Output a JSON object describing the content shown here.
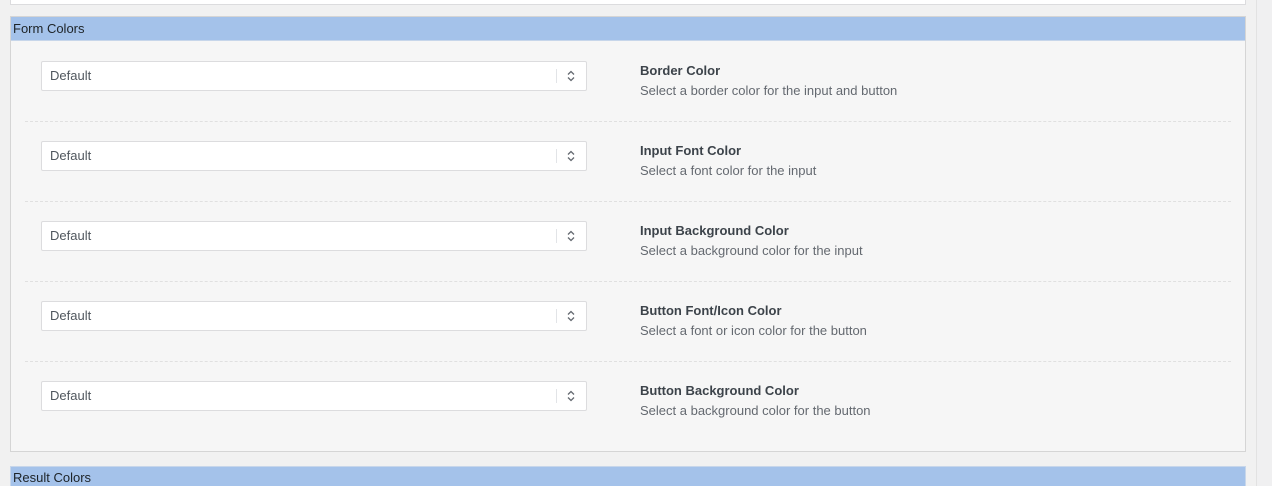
{
  "form_colors": {
    "header": "Form Colors",
    "settings": [
      {
        "value": "Default",
        "title": "Border Color",
        "description": "Select a border color for the input and button"
      },
      {
        "value": "Default",
        "title": "Input Font Color",
        "description": "Select a font color for the input"
      },
      {
        "value": "Default",
        "title": "Input Background Color",
        "description": "Select a background color for the input"
      },
      {
        "value": "Default",
        "title": "Button Font/Icon Color",
        "description": "Select a font or icon color for the button"
      },
      {
        "value": "Default",
        "title": "Button Background Color",
        "description": "Select a background color for the button"
      }
    ]
  },
  "result_colors": {
    "header": "Result Colors"
  },
  "colors": {
    "section_header_bg": "#a4c2ea",
    "panel_bg": "#f6f6f6"
  },
  "icons": {
    "select_arrow": "chevron-up-down-icon"
  }
}
